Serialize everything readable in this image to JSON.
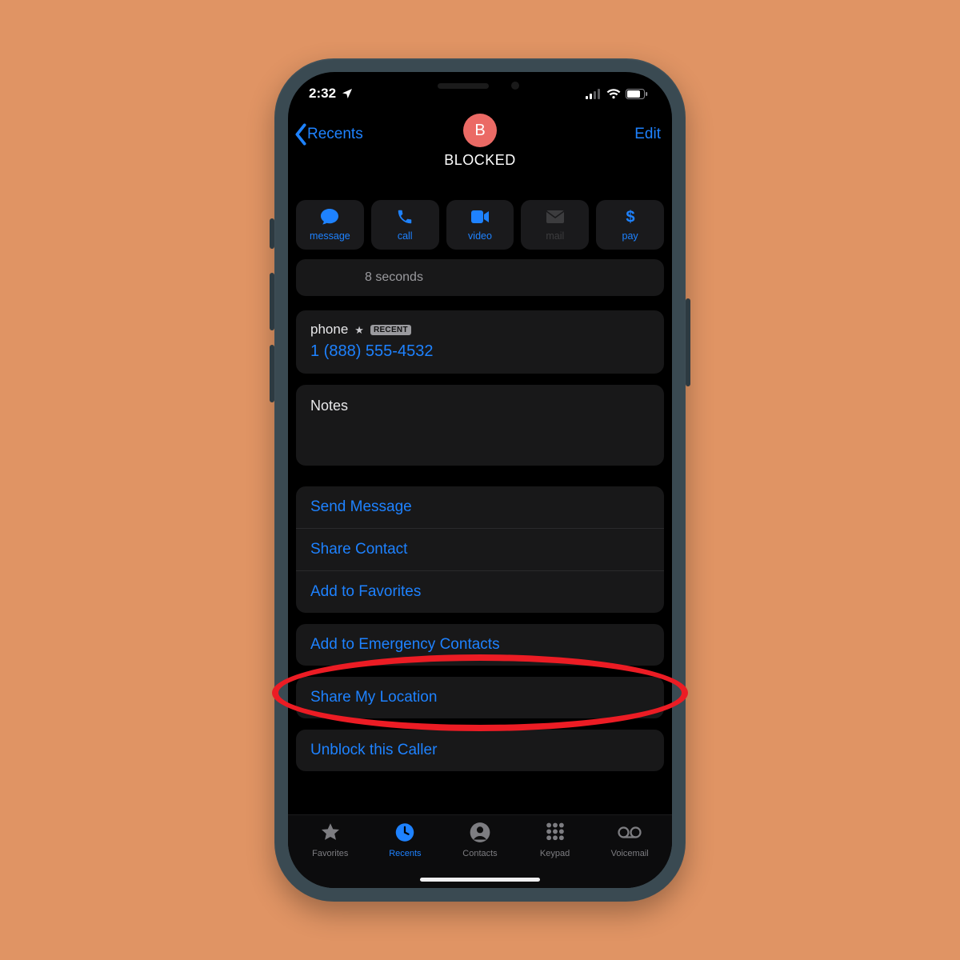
{
  "status": {
    "time": "2:32"
  },
  "nav": {
    "back_label": "Recents",
    "edit_label": "Edit",
    "avatar_initial": "B",
    "contact_name": "BLOCKED"
  },
  "actions": {
    "message": "message",
    "call": "call",
    "video": "video",
    "mail": "mail",
    "pay": "pay"
  },
  "call_duration": "8 seconds",
  "phone": {
    "label": "phone",
    "recent_tag": "RECENT",
    "number": "1 (888)  555-4532"
  },
  "notes_label": "Notes",
  "list1": {
    "send_message": "Send Message",
    "share_contact": "Share Contact",
    "add_to_favorites": "Add to Favorites"
  },
  "list2": {
    "add_to_emergency": "Add to Emergency Contacts"
  },
  "list3": {
    "share_location": "Share My Location"
  },
  "list4": {
    "unblock": "Unblock this Caller"
  },
  "tabs": {
    "favorites": "Favorites",
    "recents": "Recents",
    "contacts": "Contacts",
    "keypad": "Keypad",
    "voicemail": "Voicemail"
  }
}
